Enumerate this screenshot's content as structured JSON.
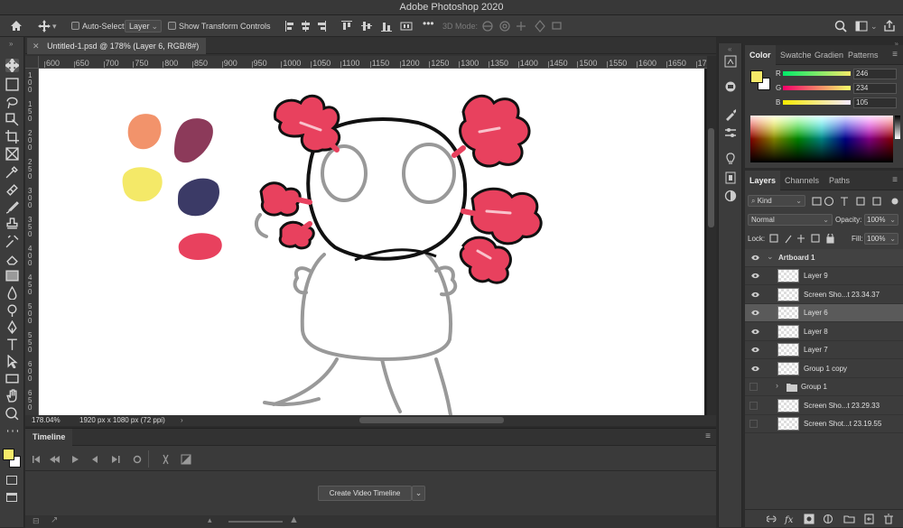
{
  "app": {
    "title": "Adobe Photoshop 2020"
  },
  "options_bar": {
    "auto_select_label": "Auto-Select:",
    "auto_select_value": "Layer",
    "show_transform_label": "Show Transform Controls",
    "mode_3d_label": "3D Mode:"
  },
  "document": {
    "tab_title": "Untitled-1.psd @ 178% (Layer 6, RGB/8#)",
    "zoom": "178.04%",
    "dimensions": "1920 px x 1080 px (72 ppi)"
  },
  "ruler": {
    "h_labels": [
      "600",
      "650",
      "700",
      "750",
      "800",
      "850",
      "900",
      "950",
      "1000",
      "1050",
      "1100",
      "1150",
      "1200",
      "1250",
      "1300",
      "1350",
      "1400",
      "1450",
      "1500",
      "1550",
      "1600",
      "1650",
      "17"
    ],
    "v_labels": [
      "1 0 0",
      "1 5 0",
      "2 0 0",
      "2 5 0",
      "3 0 0",
      "3 5 0",
      "4 0 0",
      "4 5 0",
      "5 0 0",
      "5 5 0",
      "6 0 0",
      "6 5 0"
    ]
  },
  "timeline": {
    "tab_label": "Timeline",
    "create_button_label": "Create Video Timeline"
  },
  "color_panel": {
    "tabs": [
      "Color",
      "Swatche",
      "Gradien",
      "Patterns"
    ],
    "r": {
      "label": "R",
      "value": "246"
    },
    "g": {
      "label": "G",
      "value": "234"
    },
    "b": {
      "label": "B",
      "value": "105"
    },
    "foreground_color": "#f6ea69",
    "background_color": "#ffffff"
  },
  "layers_panel": {
    "tabs": [
      "Layers",
      "Channels",
      "Paths"
    ],
    "filter_label": "Kind",
    "blend_mode": "Normal",
    "opacity_label": "Opacity:",
    "opacity_value": "100%",
    "lock_label": "Lock:",
    "fill_label": "Fill:",
    "fill_value": "100%",
    "artboard_name": "Artboard 1",
    "layers": [
      {
        "name": "Layer 9",
        "visible": true,
        "selected": false
      },
      {
        "name": "Screen Sho...t 23.34.37",
        "visible": true,
        "selected": false
      },
      {
        "name": "Layer 6",
        "visible": true,
        "selected": true
      },
      {
        "name": "Layer 8",
        "visible": true,
        "selected": false
      },
      {
        "name": "Layer 7",
        "visible": true,
        "selected": false
      },
      {
        "name": "Group 1 copy",
        "visible": true,
        "selected": false
      },
      {
        "name": "Group 1",
        "visible": false,
        "selected": false
      },
      {
        "name": "Screen Sho...t 23.29.33",
        "visible": false,
        "selected": false
      },
      {
        "name": "Screen Shot...t 23.19.55",
        "visible": false,
        "selected": false
      }
    ]
  },
  "icons": {
    "toolbar": [
      "move-icon",
      "marquee-icon",
      "lasso-icon",
      "object-select-icon",
      "crop-icon",
      "frame-icon",
      "eyedropper-icon",
      "healing-icon",
      "brush-icon",
      "stamp-icon",
      "history-brush-icon",
      "eraser-icon",
      "gradient-icon",
      "blur-icon",
      "dodge-icon",
      "pen-icon",
      "type-icon",
      "path-select-icon",
      "rectangle-icon",
      "hand-icon",
      "zoom-icon",
      "more-icon"
    ]
  },
  "artwork_colors": {
    "peach": "#f2936b",
    "plum": "#8c3a5a",
    "yellow": "#f4e968",
    "navy": "#3b3a66",
    "pink": "#e8415e"
  }
}
